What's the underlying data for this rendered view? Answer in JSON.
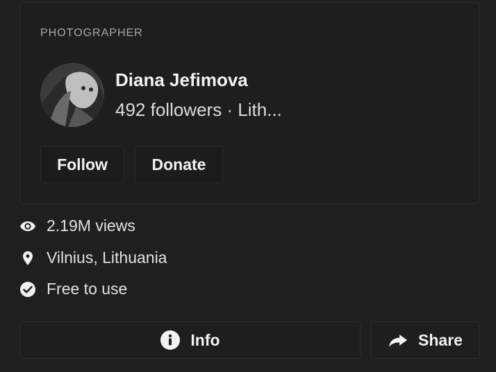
{
  "profile": {
    "role": "PHOTOGRAPHER",
    "name": "Diana Jefimova",
    "subline": "492 followers · Lith...",
    "follow_label": "Follow",
    "donate_label": "Donate"
  },
  "meta": {
    "views": "2.19M views",
    "location": "Vilnius, Lithuania",
    "license": "Free to use"
  },
  "actions": {
    "info_label": "Info",
    "share_label": "Share"
  },
  "icons": {
    "views": "eye-icon",
    "location": "map-pin-icon",
    "license": "check-circle-icon",
    "info": "info-icon",
    "share": "share-arrow-icon"
  }
}
